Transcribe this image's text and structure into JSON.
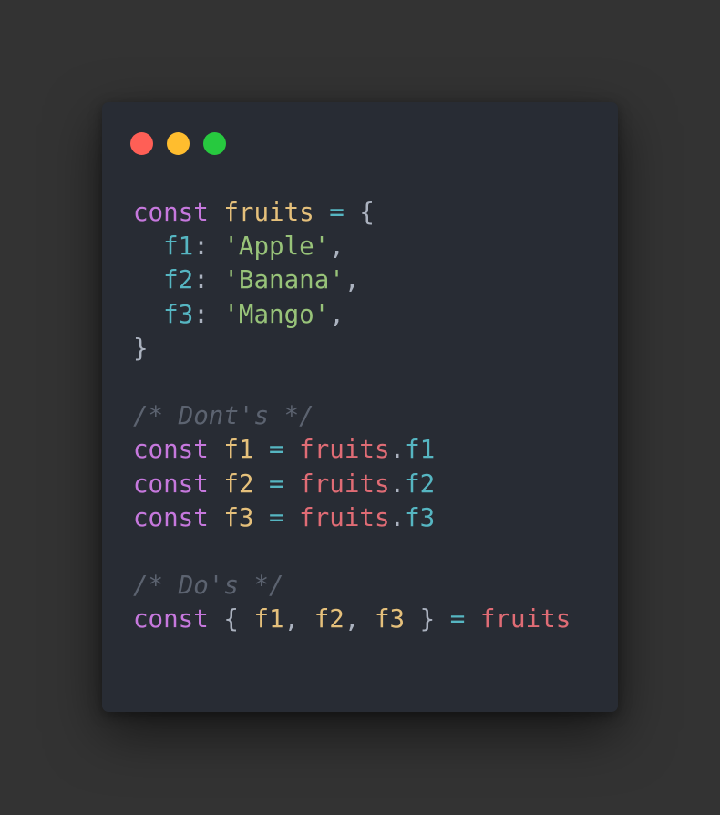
{
  "window": {
    "controls": [
      {
        "name": "close",
        "color": "#ff5f56"
      },
      {
        "name": "minimize",
        "color": "#ffbd2e"
      },
      {
        "name": "maximize",
        "color": "#27c93f"
      }
    ]
  },
  "code": {
    "lines": [
      [
        {
          "t": "const",
          "k": "kw"
        },
        {
          "t": " ",
          "k": "ws"
        },
        {
          "t": "fruits",
          "k": "var"
        },
        {
          "t": " ",
          "k": "ws"
        },
        {
          "t": "=",
          "k": "op"
        },
        {
          "t": " ",
          "k": "ws"
        },
        {
          "t": "{",
          "k": "punc"
        }
      ],
      [
        {
          "t": "  ",
          "k": "ws"
        },
        {
          "t": "f1",
          "k": "prop"
        },
        {
          "t": ": ",
          "k": "punc"
        },
        {
          "t": "'Apple'",
          "k": "str"
        },
        {
          "t": ",",
          "k": "punc"
        }
      ],
      [
        {
          "t": "  ",
          "k": "ws"
        },
        {
          "t": "f2",
          "k": "prop"
        },
        {
          "t": ": ",
          "k": "punc"
        },
        {
          "t": "'Banana'",
          "k": "str"
        },
        {
          "t": ",",
          "k": "punc"
        }
      ],
      [
        {
          "t": "  ",
          "k": "ws"
        },
        {
          "t": "f3",
          "k": "prop"
        },
        {
          "t": ": ",
          "k": "punc"
        },
        {
          "t": "'Mango'",
          "k": "str"
        },
        {
          "t": ",",
          "k": "punc"
        }
      ],
      [
        {
          "t": "}",
          "k": "punc"
        }
      ],
      [],
      [
        {
          "t": "/* Dont's */",
          "k": "cmt"
        }
      ],
      [
        {
          "t": "const",
          "k": "kw"
        },
        {
          "t": " ",
          "k": "ws"
        },
        {
          "t": "f1",
          "k": "var"
        },
        {
          "t": " ",
          "k": "ws"
        },
        {
          "t": "=",
          "k": "op"
        },
        {
          "t": " ",
          "k": "ws"
        },
        {
          "t": "fruits",
          "k": "obj"
        },
        {
          "t": ".",
          "k": "punc"
        },
        {
          "t": "f1",
          "k": "prop"
        }
      ],
      [
        {
          "t": "const",
          "k": "kw"
        },
        {
          "t": " ",
          "k": "ws"
        },
        {
          "t": "f2",
          "k": "var"
        },
        {
          "t": " ",
          "k": "ws"
        },
        {
          "t": "=",
          "k": "op"
        },
        {
          "t": " ",
          "k": "ws"
        },
        {
          "t": "fruits",
          "k": "obj"
        },
        {
          "t": ".",
          "k": "punc"
        },
        {
          "t": "f2",
          "k": "prop"
        }
      ],
      [
        {
          "t": "const",
          "k": "kw"
        },
        {
          "t": " ",
          "k": "ws"
        },
        {
          "t": "f3",
          "k": "var"
        },
        {
          "t": " ",
          "k": "ws"
        },
        {
          "t": "=",
          "k": "op"
        },
        {
          "t": " ",
          "k": "ws"
        },
        {
          "t": "fruits",
          "k": "obj"
        },
        {
          "t": ".",
          "k": "punc"
        },
        {
          "t": "f3",
          "k": "prop"
        }
      ],
      [],
      [
        {
          "t": "/* Do's */",
          "k": "cmt"
        }
      ],
      [
        {
          "t": "const",
          "k": "kw"
        },
        {
          "t": " ",
          "k": "ws"
        },
        {
          "t": "{",
          "k": "punc"
        },
        {
          "t": " ",
          "k": "ws"
        },
        {
          "t": "f1",
          "k": "var"
        },
        {
          "t": ", ",
          "k": "punc"
        },
        {
          "t": "f2",
          "k": "var"
        },
        {
          "t": ", ",
          "k": "punc"
        },
        {
          "t": "f3",
          "k": "var"
        },
        {
          "t": " ",
          "k": "ws"
        },
        {
          "t": "}",
          "k": "punc"
        },
        {
          "t": " ",
          "k": "ws"
        },
        {
          "t": "=",
          "k": "op"
        },
        {
          "t": " ",
          "k": "ws"
        },
        {
          "t": "fruits",
          "k": "obj"
        }
      ]
    ]
  }
}
